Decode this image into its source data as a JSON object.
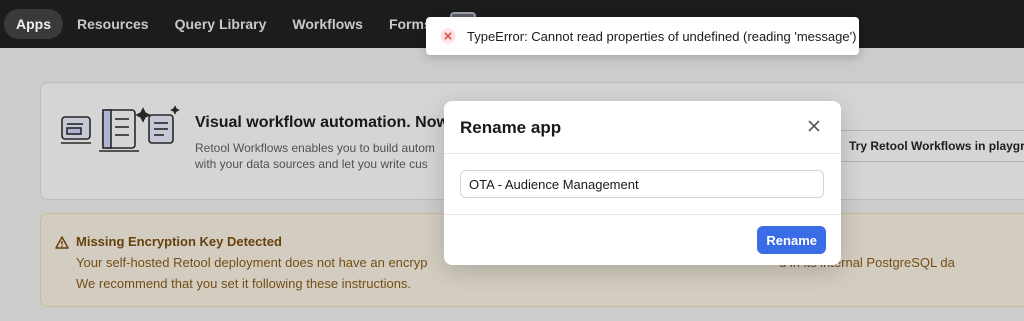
{
  "nav": {
    "items": [
      {
        "label": "Apps",
        "active": true
      },
      {
        "label": "Resources",
        "active": false
      },
      {
        "label": "Query Library",
        "active": false
      },
      {
        "label": "Workflows",
        "active": false
      },
      {
        "label": "Forms",
        "active": false
      }
    ]
  },
  "promo": {
    "title": "Visual workflow automation. Now w",
    "description_lines": [
      "Retool Workflows enables you to build autom",
      "with your data sources and let you write cus"
    ],
    "cta_label": "Try Retool Workflows in playground"
  },
  "warning": {
    "title": "Missing Encryption Key Detected",
    "lines": [
      "Your self-hosted Retool deployment does not have an encryp",
      "We recommend that you set it following these instructions."
    ],
    "line_tail": "d in its internal PostgreSQL da"
  },
  "modal": {
    "title": "Rename app",
    "input_value": "OTA - Audience Management",
    "rename_label": "Rename"
  },
  "toast": {
    "message": "TypeError: Cannot read properties of undefined (reading 'message')"
  },
  "colors": {
    "nav_bg": "#1c1c1c",
    "primary": "#3b6ce8",
    "error": "#e5484d",
    "warning_bg": "#fdf6e7"
  },
  "icons": {
    "toast": "error-circle-icon",
    "close": "close-icon",
    "warning": "warning-triangle-icon"
  }
}
